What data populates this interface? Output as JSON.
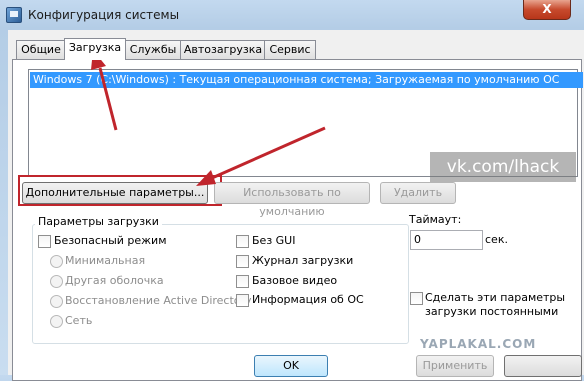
{
  "window": {
    "title": "Конфигурация системы",
    "close_label": "X"
  },
  "tabs": [
    {
      "label": "Общие"
    },
    {
      "label": "Загрузка"
    },
    {
      "label": "Службы"
    },
    {
      "label": "Автозагрузка"
    },
    {
      "label": "Сервис"
    }
  ],
  "os_list": {
    "selected": "Windows 7 (C:\\Windows) : Текущая операционная система; Загружаемая по умолчанию ОС"
  },
  "buttons": {
    "advanced": "Дополнительные параметры...",
    "set_default": "Использовать по умолчанию",
    "delete": "Удалить",
    "ok": "OK",
    "apply": "Применить"
  },
  "boot_options": {
    "group_label": "Параметры загрузки",
    "safe_boot": "Безопасный режим",
    "minimal": "Минимальная",
    "alternate_shell": "Другая оболочка",
    "ad_repair": "Восстановление Active Directory",
    "network": "Сеть",
    "no_gui": "Без GUI",
    "boot_log": "Журнал загрузки",
    "base_video": "Базовое видео",
    "os_info": "Информация об ОС"
  },
  "timeout": {
    "label": "Таймаут:",
    "value": "0",
    "unit": "сек."
  },
  "make_permanent": {
    "line1": "Сделать эти параметры",
    "line2": "загрузки постоянными"
  },
  "watermarks": {
    "vk": "vk.com/lhack",
    "site": "YAPLAKAL.COM"
  },
  "colors": {
    "selection": "#3399ff",
    "annotation_red": "#c0252c"
  }
}
